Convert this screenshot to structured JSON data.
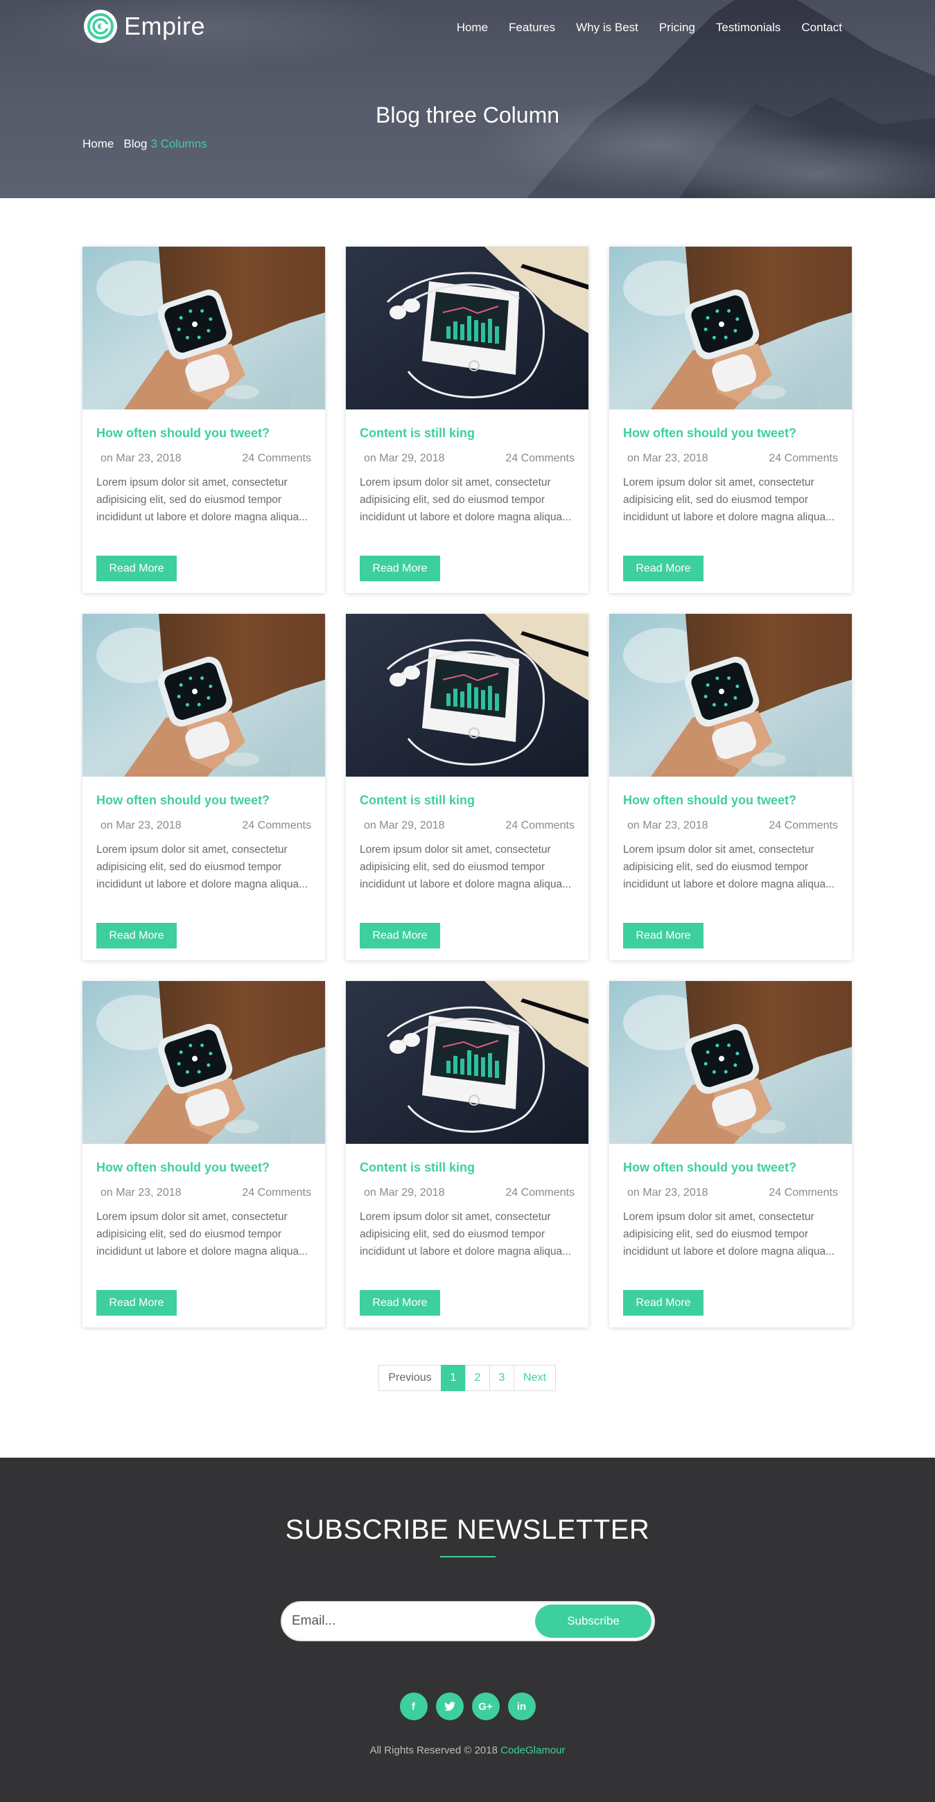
{
  "header": {
    "brand": "Empire",
    "nav": [
      "Home",
      "Features",
      "Why is Best",
      "Pricing",
      "Testimonials",
      "Contact"
    ],
    "page_title": "Blog three Column",
    "breadcrumb": {
      "home": "Home",
      "blog": "Blog",
      "current": "3 Columns"
    }
  },
  "posts": [
    {
      "image": "smartwatch",
      "title": "How often should you tweet?",
      "date": "on Mar 23, 2018",
      "comments": "24 Comments",
      "excerpt": "Lorem ipsum dolor sit amet, consectetur adipisicing elit, sed do eiusmod tempor incididunt ut labore et dolore magna aliqua...",
      "button": "Read More"
    },
    {
      "image": "phone",
      "title": "Content is still king",
      "date": "on Mar 29, 2018",
      "comments": "24 Comments",
      "excerpt": "Lorem ipsum dolor sit amet, consectetur adipisicing elit, sed do eiusmod tempor incididunt ut labore et dolore magna aliqua...",
      "button": "Read More"
    },
    {
      "image": "smartwatch",
      "title": "How often should you tweet?",
      "date": "on Mar 23, 2018",
      "comments": "24 Comments",
      "excerpt": "Lorem ipsum dolor sit amet, consectetur adipisicing elit, sed do eiusmod tempor incididunt ut labore et dolore magna aliqua...",
      "button": "Read More"
    },
    {
      "image": "smartwatch",
      "title": "How often should you tweet?",
      "date": "on Mar 23, 2018",
      "comments": "24 Comments",
      "excerpt": "Lorem ipsum dolor sit amet, consectetur adipisicing elit, sed do eiusmod tempor incididunt ut labore et dolore magna aliqua...",
      "button": "Read More"
    },
    {
      "image": "phone",
      "title": "Content is still king",
      "date": "on Mar 29, 2018",
      "comments": "24 Comments",
      "excerpt": "Lorem ipsum dolor sit amet, consectetur adipisicing elit, sed do eiusmod tempor incididunt ut labore et dolore magna aliqua...",
      "button": "Read More"
    },
    {
      "image": "smartwatch",
      "title": "How often should you tweet?",
      "date": "on Mar 23, 2018",
      "comments": "24 Comments",
      "excerpt": "Lorem ipsum dolor sit amet, consectetur adipisicing elit, sed do eiusmod tempor incididunt ut labore et dolore magna aliqua...",
      "button": "Read More"
    },
    {
      "image": "smartwatch",
      "title": "How often should you tweet?",
      "date": "on Mar 23, 2018",
      "comments": "24 Comments",
      "excerpt": "Lorem ipsum dolor sit amet, consectetur adipisicing elit, sed do eiusmod tempor incididunt ut labore et dolore magna aliqua...",
      "button": "Read More"
    },
    {
      "image": "phone",
      "title": "Content is still king",
      "date": "on Mar 29, 2018",
      "comments": "24 Comments",
      "excerpt": "Lorem ipsum dolor sit amet, consectetur adipisicing elit, sed do eiusmod tempor incididunt ut labore et dolore magna aliqua...",
      "button": "Read More"
    },
    {
      "image": "smartwatch",
      "title": "How often should you tweet?",
      "date": "on Mar 23, 2018",
      "comments": "24 Comments",
      "excerpt": "Lorem ipsum dolor sit amet, consectetur adipisicing elit, sed do eiusmod tempor incididunt ut labore et dolore magna aliqua...",
      "button": "Read More"
    }
  ],
  "pagination": {
    "previous": "Previous",
    "pages": [
      "1",
      "2",
      "3"
    ],
    "active_page": "1",
    "next": "Next"
  },
  "newsletter": {
    "title": "SUBSCRIBE NEWSLETTER",
    "email_placeholder": "Email...",
    "email_value": "",
    "button": "Subscribe"
  },
  "footer": {
    "socials": [
      {
        "icon": "facebook-icon",
        "glyph": "f"
      },
      {
        "icon": "twitter-icon",
        "glyph": "t"
      },
      {
        "icon": "google-plus-icon",
        "glyph": "G+"
      },
      {
        "icon": "linkedin-icon",
        "glyph": "in"
      }
    ],
    "copyright": "All Rights Reserved © 2018",
    "brand": "CodeGlamour"
  },
  "colors": {
    "accent": "#3ecf9e",
    "hero": "#565b6a",
    "footer": "#333335"
  }
}
